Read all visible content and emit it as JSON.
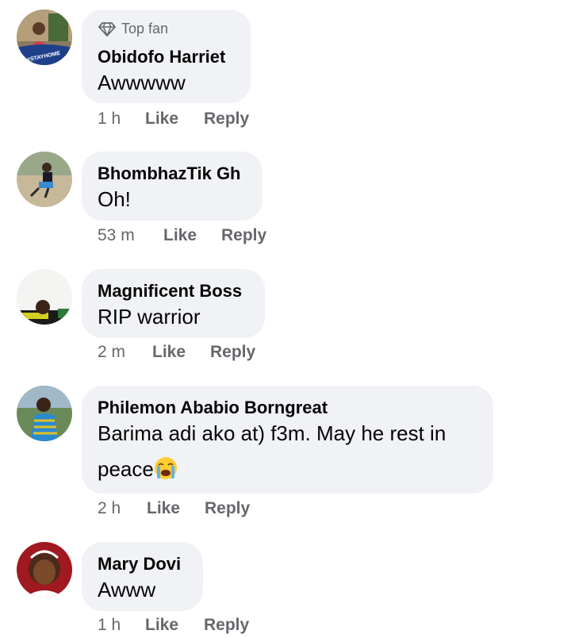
{
  "comments": [
    {
      "badge": "Top fan",
      "badge_icon": "diamond-icon",
      "author": "Obidofo Harriet",
      "text": "Awwwww",
      "time": "1 h",
      "like": "Like",
      "reply": "Reply",
      "avatar_caption": "#STAYHOME"
    },
    {
      "author": "BhombhazTik Gh",
      "text": "Oh!",
      "time": "53 m",
      "like": "Like",
      "reply": "Reply"
    },
    {
      "author": "Magnificent Boss",
      "text": "RIP warrior",
      "time": "2 m",
      "like": "Like",
      "reply": "Reply"
    },
    {
      "author": "Philemon Ababio Borngreat",
      "text_line1": "Barima adi ako at) f3m. May he rest in",
      "text_line2": "peace",
      "emoji": "loudly-crying-face-icon",
      "time": "2 h",
      "like": "Like",
      "reply": "Reply"
    },
    {
      "author": "Mary Dovi",
      "text": "Awww",
      "time": "1 h",
      "like": "Like",
      "reply": "Reply"
    }
  ],
  "colors": {
    "bubble": "#f0f2f5",
    "meta": "#65676b",
    "text": "#050505"
  }
}
